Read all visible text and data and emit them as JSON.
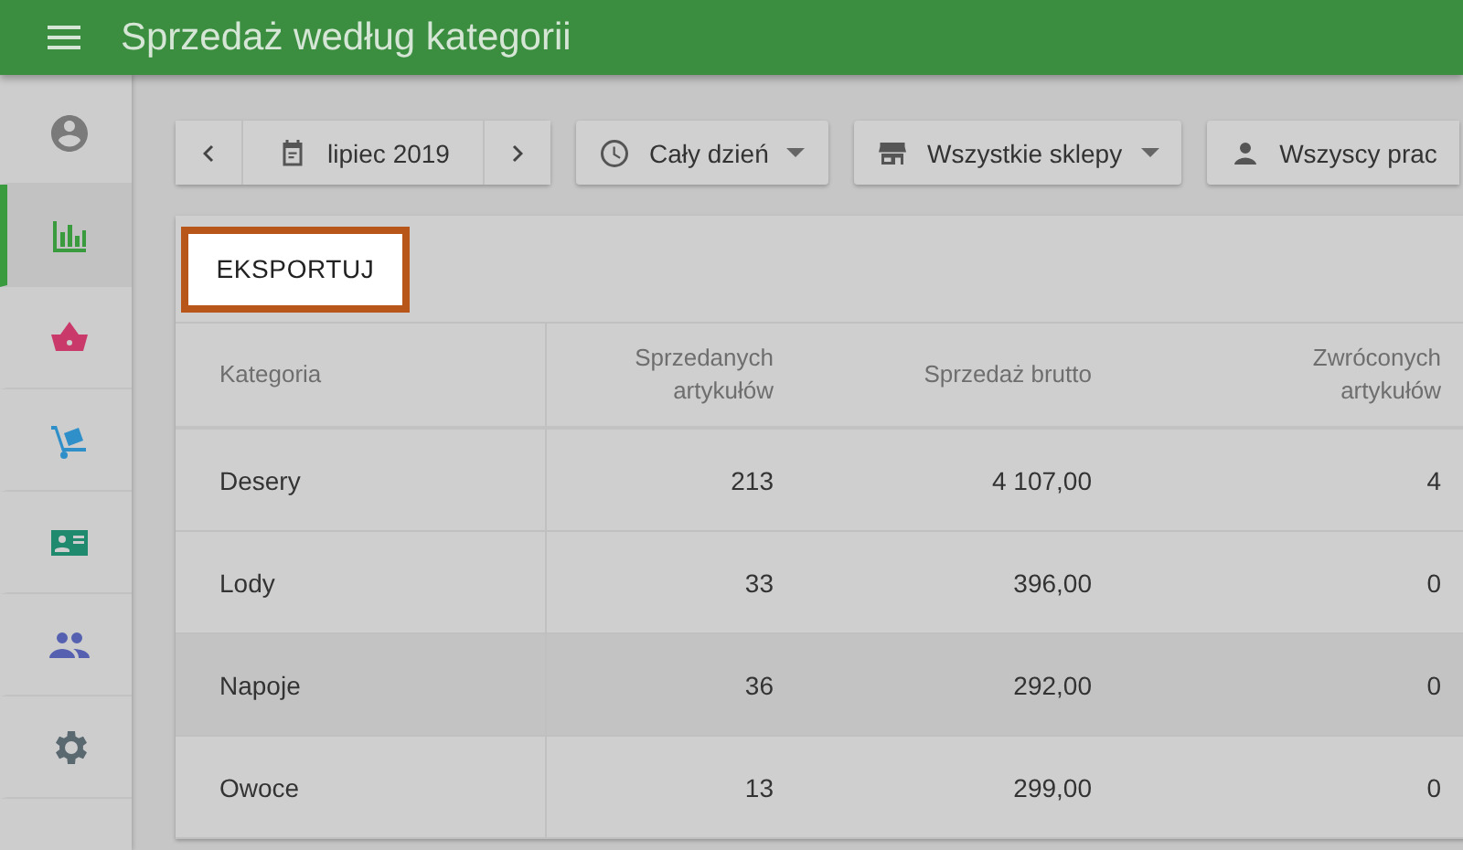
{
  "app_bar": {
    "title": "Sprzedaż według kategorii"
  },
  "sidebar": {
    "items": [
      {
        "selected": false
      },
      {
        "selected": true
      },
      {
        "selected": false
      },
      {
        "selected": false
      },
      {
        "selected": false
      },
      {
        "selected": false
      },
      {
        "selected": false
      }
    ]
  },
  "filters": {
    "period": "lipiec 2019",
    "time": "Cały dzień",
    "store": "Wszystkie sklepy",
    "employee": "Wszyscy prac"
  },
  "export_button": "EKSPORTUJ",
  "table": {
    "columns": [
      "Kategoria",
      "Sprzedanych artykułów",
      "Sprzedaż brutto",
      "Zwróconych artykułów"
    ],
    "rows": [
      {
        "cells": [
          "Desery",
          "213",
          "4 107,00",
          "4"
        ],
        "selected": false
      },
      {
        "cells": [
          "Lody",
          "33",
          "396,00",
          "0"
        ],
        "selected": false
      },
      {
        "cells": [
          "Napoje",
          "36",
          "292,00",
          "0"
        ],
        "selected": true
      },
      {
        "cells": [
          "Owoce",
          "13",
          "299,00",
          "0"
        ],
        "selected": false
      }
    ]
  }
}
